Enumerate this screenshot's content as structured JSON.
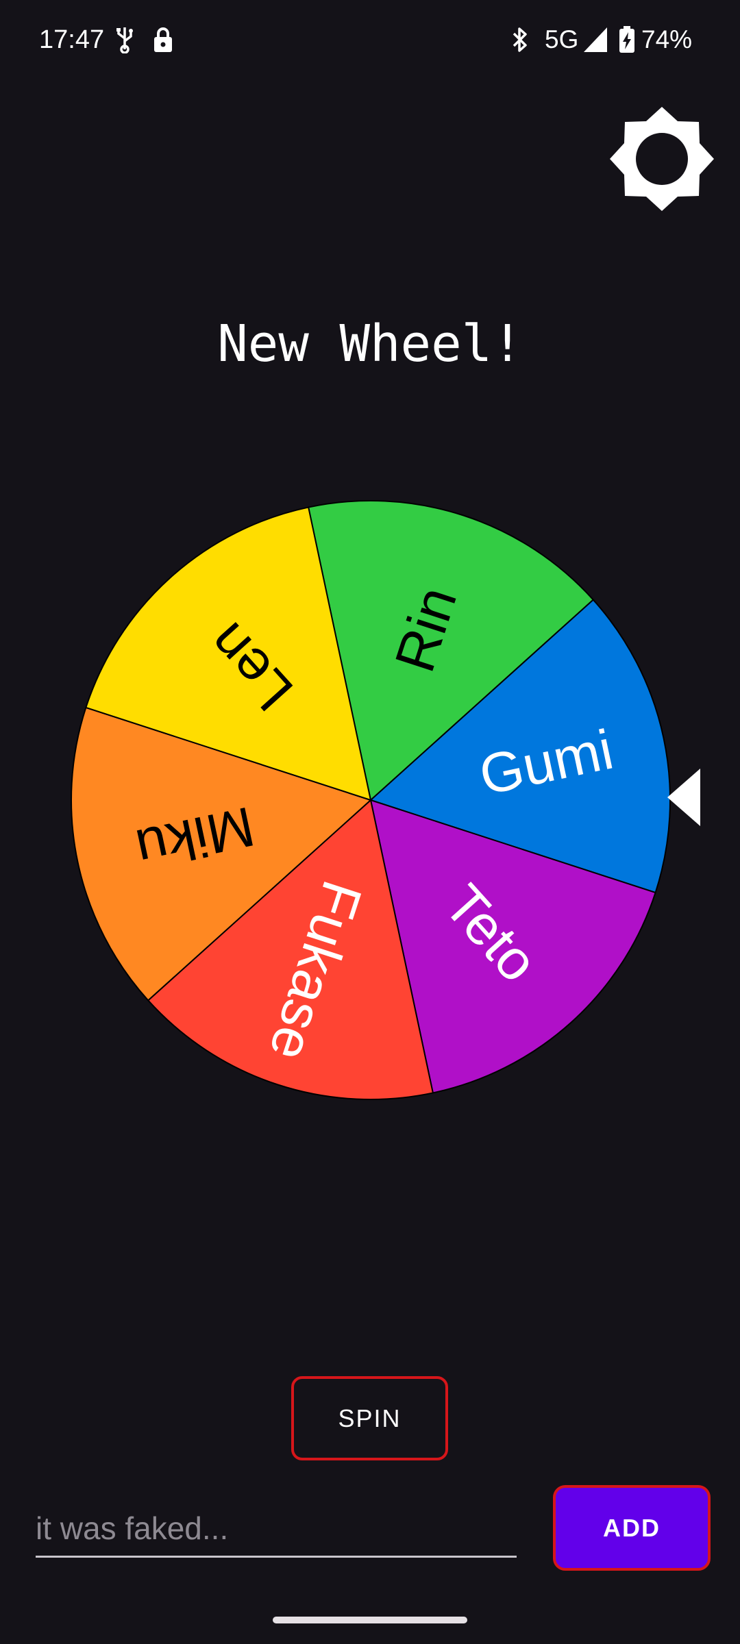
{
  "status_bar": {
    "time": "17:47",
    "network": "5G",
    "battery": "74%",
    "icons": [
      "usb-icon",
      "lock-icon",
      "bluetooth-icon",
      "signal-icon",
      "battery-charging-icon"
    ]
  },
  "header": {
    "settings_icon": "brightness-icon"
  },
  "wheel": {
    "title": "New Wheel!",
    "segments": [
      {
        "label": "Rin",
        "color": "#33cc44"
      },
      {
        "label": "Gumi",
        "color": "#0077dd"
      },
      {
        "label": "Teto",
        "color": "#b010c8"
      },
      {
        "label": "Fukase",
        "color": "#ff4433"
      },
      {
        "label": "Miku",
        "color": "#ff8822"
      },
      {
        "label": "Len",
        "color": "#ffdd00"
      }
    ],
    "pointer_icon": "pointer-triangle-icon"
  },
  "controls": {
    "spin_label": "SPIN",
    "input_placeholder": "it was faked...",
    "add_label": "ADD"
  },
  "colors": {
    "background": "#141218",
    "button_border": "#d6161a",
    "add_button_fill": "#6200ea"
  }
}
